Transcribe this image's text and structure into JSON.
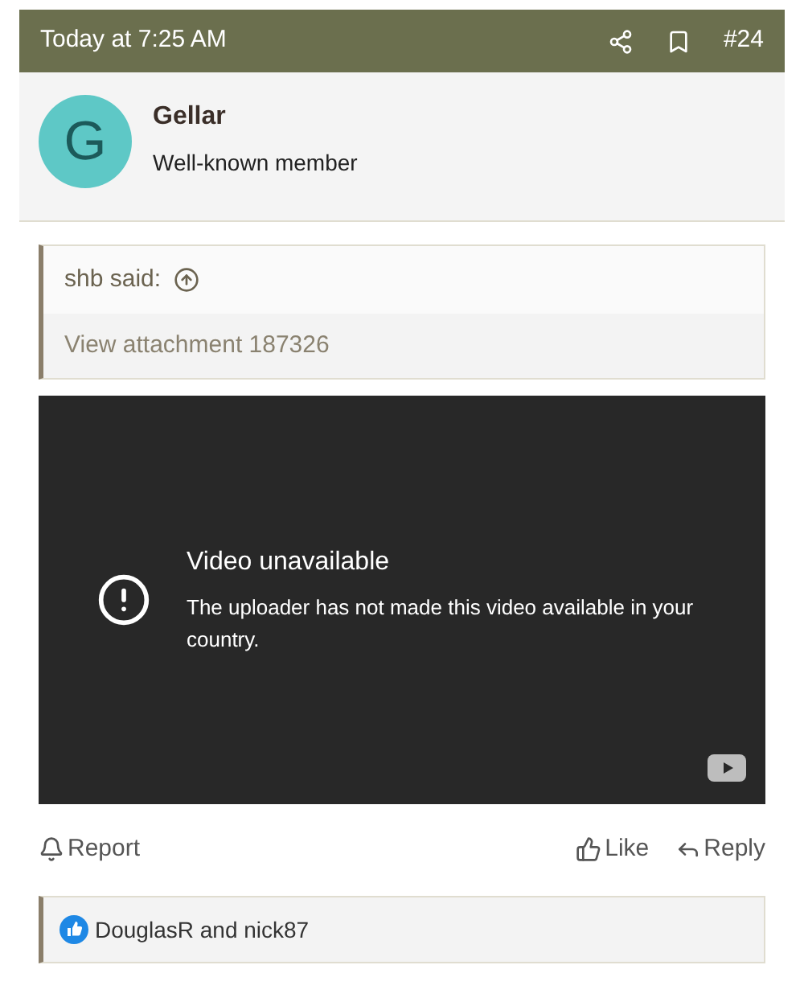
{
  "header": {
    "time": "Today at 7:25 AM",
    "post_number": "#24"
  },
  "author": {
    "avatar_letter": "G",
    "name": "Gellar",
    "title": "Well-known member"
  },
  "quote": {
    "attribution": "shb said:",
    "attachment": "View attachment 187326"
  },
  "video": {
    "title": "Video unavailable",
    "message": "The uploader has not made this video available in your country."
  },
  "actions": [
    {
      "kind": "report",
      "label": "Report"
    },
    {
      "kind": "like",
      "label": "Like"
    },
    {
      "kind": "reply",
      "label": "Reply"
    }
  ],
  "reactions": {
    "text": "DouglasR and nick87"
  }
}
